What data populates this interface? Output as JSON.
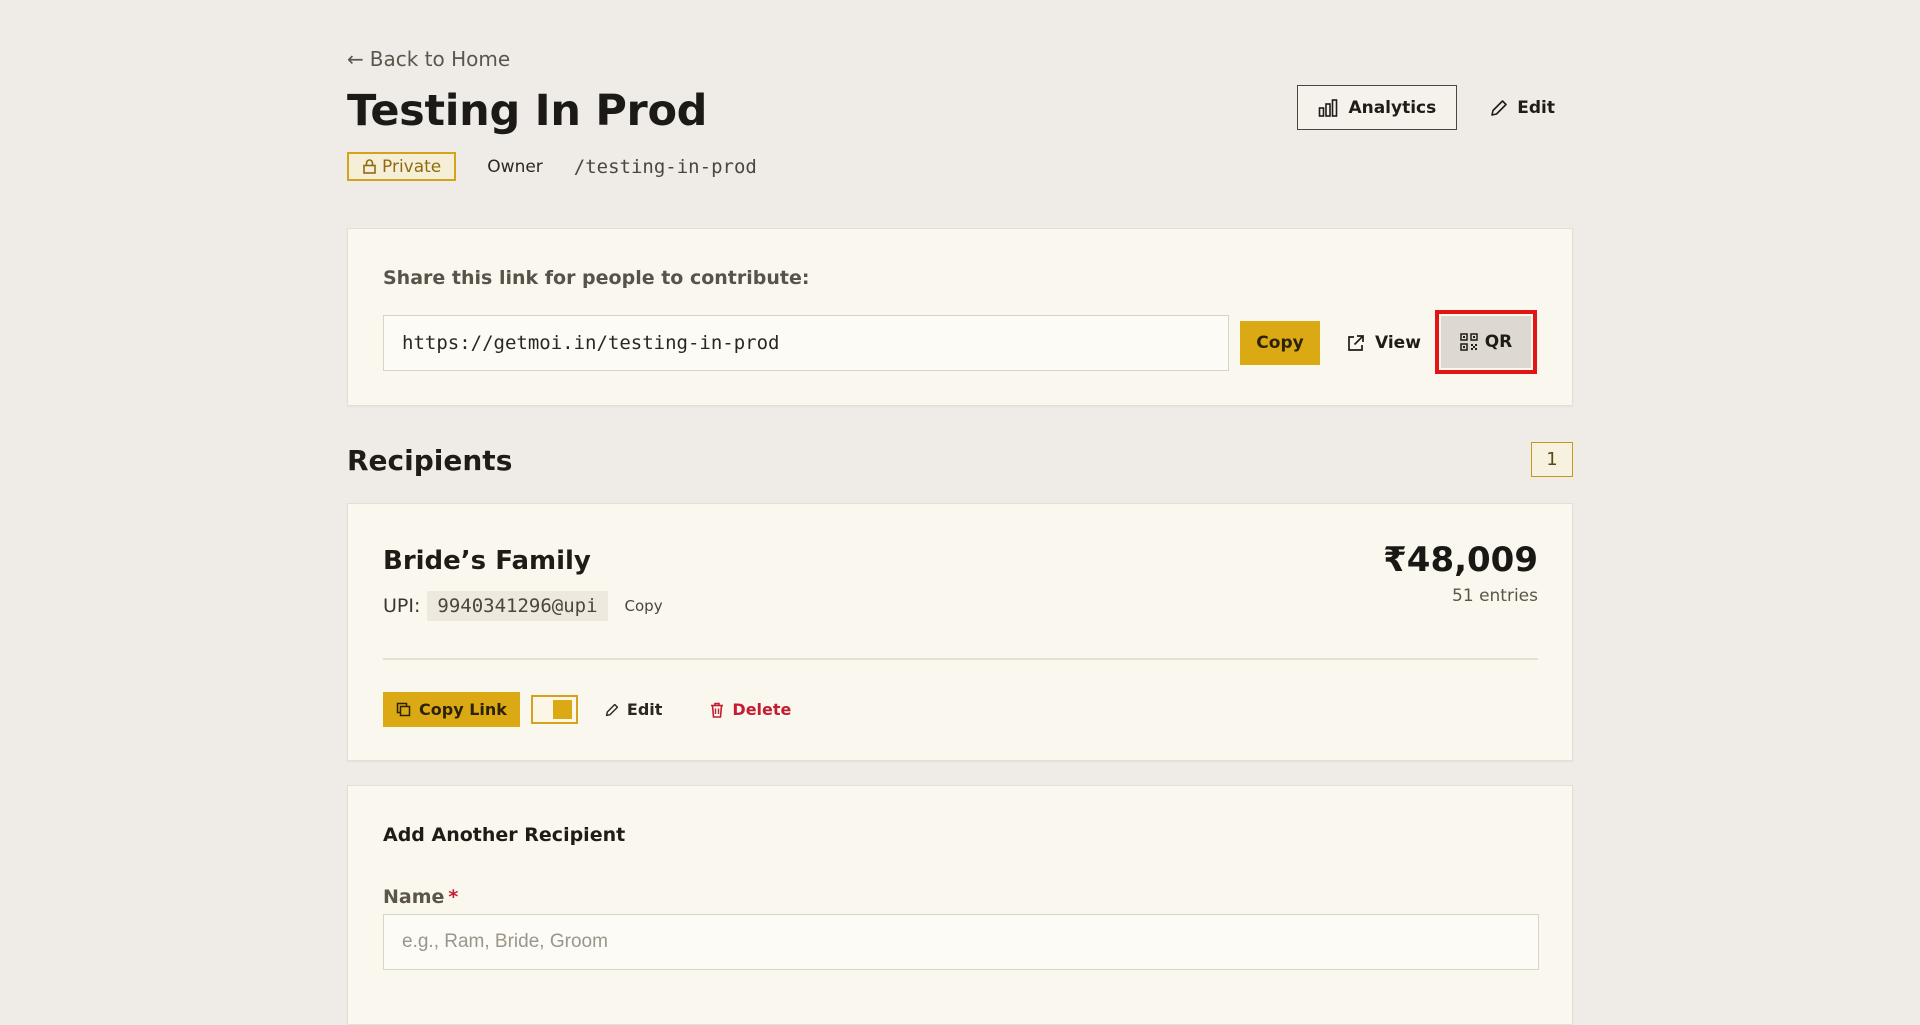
{
  "nav": {
    "back_label": "Back to Home"
  },
  "header": {
    "title": "Testing In Prod",
    "private_label": "Private",
    "owner_label": "Owner",
    "slug": "/testing-in-prod",
    "analytics_label": "Analytics",
    "edit_label": "Edit"
  },
  "share": {
    "label": "Share this link for people to contribute:",
    "url": "https://getmoi.in/testing-in-prod",
    "copy_label": "Copy",
    "view_label": "View",
    "qr_label": "QR"
  },
  "recipients": {
    "title": "Recipients",
    "count": "1",
    "items": [
      {
        "name": "Bride’s Family",
        "upi_label": "UPI:",
        "upi": "9940341296@upi",
        "upi_copy_label": "Copy",
        "amount": "₹48,009",
        "entries": "51 entries",
        "copy_link_label": "Copy Link",
        "edit_label": "Edit",
        "delete_label": "Delete",
        "toggle_on": true
      }
    ]
  },
  "add_recipient": {
    "title": "Add Another Recipient",
    "name_label": "Name",
    "required_mark": "*",
    "name_placeholder": "e.g., Ram, Bride, Groom"
  },
  "colors": {
    "accent": "#dba913",
    "background": "#efece7",
    "card": "#faf7ee",
    "danger": "#c41d32",
    "highlight": "#e21515"
  }
}
